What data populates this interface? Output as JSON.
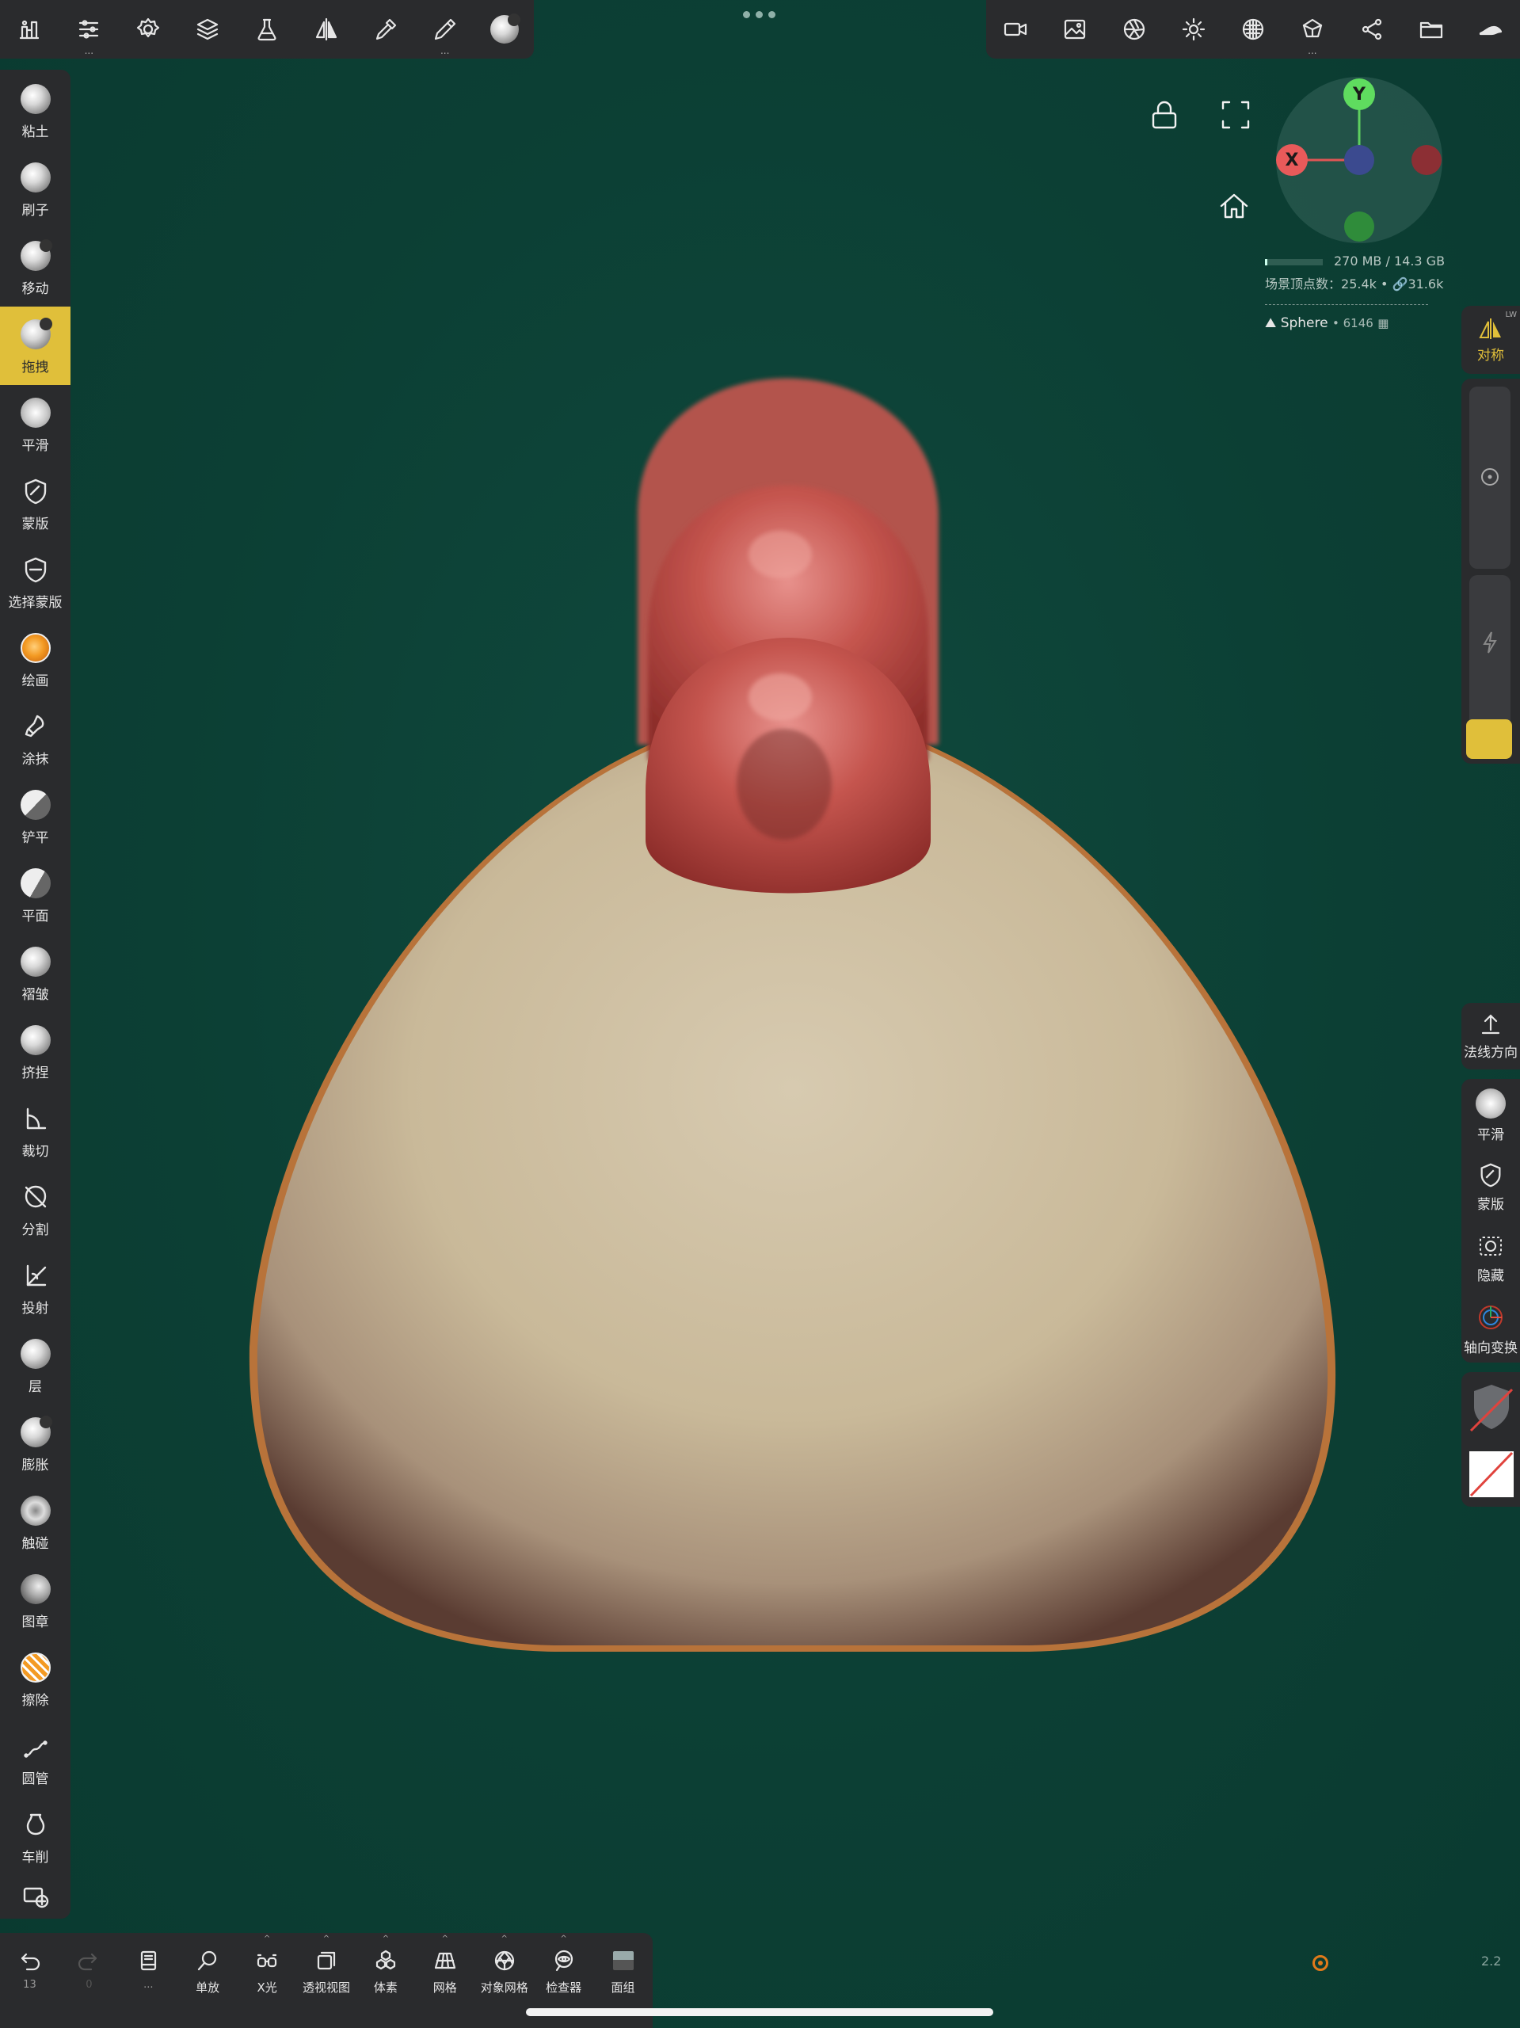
{
  "top_toolbar_left": [
    {
      "icon": "scene-icon",
      "has_more": false
    },
    {
      "icon": "sliders-icon",
      "has_more": true
    },
    {
      "icon": "gear-icon",
      "has_more": false
    },
    {
      "icon": "layers-icon",
      "has_more": false
    },
    {
      "icon": "flask-icon",
      "has_more": false
    },
    {
      "icon": "symmetry-icon",
      "has_more": false
    },
    {
      "icon": "picker-icon",
      "has_more": false
    },
    {
      "icon": "pen-icon",
      "has_more": true
    },
    {
      "icon": "material-ball-icon",
      "has_more": false
    }
  ],
  "top_toolbar_right": [
    {
      "icon": "camera-icon"
    },
    {
      "icon": "image-icon"
    },
    {
      "icon": "aperture-icon"
    },
    {
      "icon": "sun-icon"
    },
    {
      "icon": "sphere-grid-icon"
    },
    {
      "icon": "shading-icon",
      "has_more": true
    },
    {
      "icon": "share-nodes-icon"
    },
    {
      "icon": "folder-icon"
    },
    {
      "icon": "app-logo-icon"
    }
  ],
  "tools": [
    {
      "label": "粘土",
      "icon": "clay-icon"
    },
    {
      "label": "刷子",
      "icon": "brush-icon"
    },
    {
      "label": "移动",
      "icon": "move-icon"
    },
    {
      "label": "拖拽",
      "icon": "drag-icon",
      "active": true
    },
    {
      "label": "平滑",
      "icon": "smooth-icon"
    },
    {
      "label": "蒙版",
      "icon": "mask-icon"
    },
    {
      "label": "选择蒙版",
      "icon": "select-mask-icon"
    },
    {
      "label": "绘画",
      "icon": "paint-icon"
    },
    {
      "label": "涂抹",
      "icon": "smudge-icon"
    },
    {
      "label": "铲平",
      "icon": "flatten-icon"
    },
    {
      "label": "平面",
      "icon": "planar-icon"
    },
    {
      "label": "褶皱",
      "icon": "crease-icon"
    },
    {
      "label": "挤捏",
      "icon": "pinch-icon"
    },
    {
      "label": "裁切",
      "icon": "trim-icon"
    },
    {
      "label": "分割",
      "icon": "split-icon"
    },
    {
      "label": "投射",
      "icon": "project-icon"
    },
    {
      "label": "层",
      "icon": "layer-icon"
    },
    {
      "label": "膨胀",
      "icon": "inflate-icon"
    },
    {
      "label": "触碰",
      "icon": "tube-touch-icon"
    },
    {
      "label": "图章",
      "icon": "stamp-icon"
    },
    {
      "label": "擦除",
      "icon": "erase-icon"
    },
    {
      "label": "圆管",
      "icon": "tube-icon"
    },
    {
      "label": "车削",
      "icon": "lathe-icon"
    }
  ],
  "right_panel": {
    "symmetry_label": "对称",
    "symmetry_badge": "LW",
    "normal_label": "法线方向",
    "smooth_label": "平滑",
    "mask_label": "蒙版",
    "hide_label": "隐藏",
    "gizmo_label": "轴向变换"
  },
  "gizmo": {
    "x_label": "X",
    "y_label": "Y"
  },
  "stats": {
    "memory": "270 MB / 14.3 GB",
    "vertices_label": "场景顶点数：",
    "vertices": "25.4k",
    "links": "31.6k"
  },
  "mesh": {
    "name": "Sphere",
    "count": "6146"
  },
  "bottom_toolbar": [
    {
      "label": "13",
      "icon": "undo-icon",
      "dim": true
    },
    {
      "label": "0",
      "icon": "redo-icon",
      "dim": true
    },
    {
      "label": "...",
      "icon": "book-icon",
      "dim": true
    },
    {
      "label": "单放",
      "icon": "solo-search-icon"
    },
    {
      "label": "X光",
      "icon": "xray-glasses-icon",
      "caret": true
    },
    {
      "label": "透视视图",
      "icon": "perspective-icon",
      "caret": true
    },
    {
      "label": "体素",
      "icon": "voxel-icon",
      "caret": true
    },
    {
      "label": "网格",
      "icon": "grid-icon",
      "caret": true
    },
    {
      "label": "对象网格",
      "icon": "wireframe-icon",
      "caret": true
    },
    {
      "label": "检查器",
      "icon": "inspector-icon",
      "caret": true
    },
    {
      "label": "面组",
      "icon": "facegroup-icon"
    }
  ],
  "version": "2.2",
  "colors": {
    "accent": "#e0bf3a",
    "panel": "#2a2b2d",
    "background": "#0d4237",
    "body": "#cfc2a4",
    "comb": "#c7524a"
  }
}
